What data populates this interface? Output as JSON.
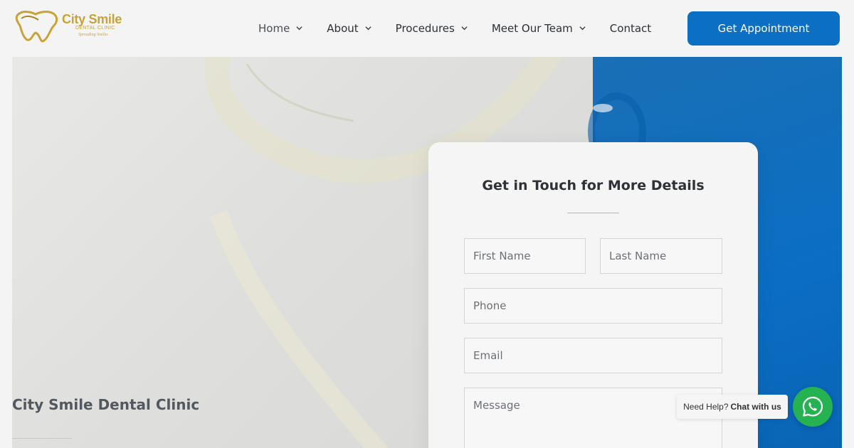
{
  "brand": {
    "name": "City Smile",
    "sub": "DENTAL CLINIC",
    "tagline": "Spreading Smiles",
    "colors": {
      "gold": "#c9a336",
      "blue": "#0b6fc4",
      "whatsapp": "#25b351"
    }
  },
  "nav": {
    "items": [
      {
        "label": "Home",
        "dropdown": true
      },
      {
        "label": "About",
        "dropdown": true
      },
      {
        "label": "Procedures",
        "dropdown": true
      },
      {
        "label": "Meet Our Team",
        "dropdown": true
      },
      {
        "label": "Contact",
        "dropdown": false
      }
    ],
    "cta": "Get Appointment"
  },
  "hero": {
    "title": "City Smile Dental Clinic"
  },
  "form": {
    "title": "Get in Touch for More Details",
    "fields": {
      "first_name": {
        "placeholder": "First Name",
        "value": ""
      },
      "last_name": {
        "placeholder": "Last Name",
        "value": ""
      },
      "phone": {
        "placeholder": "Phone",
        "value": ""
      },
      "email": {
        "placeholder": "Email",
        "value": ""
      },
      "message": {
        "placeholder": "Message",
        "value": ""
      }
    }
  },
  "whatsapp": {
    "prompt": "Need Help?",
    "action": "Chat with us",
    "icon": "whatsapp-icon"
  }
}
